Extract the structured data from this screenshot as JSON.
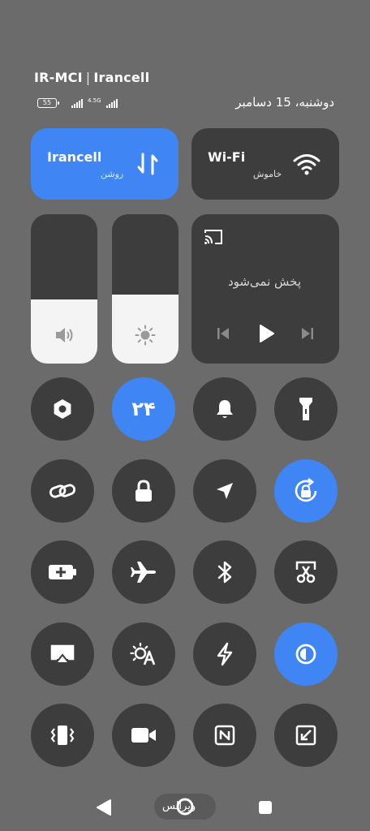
{
  "status": {
    "carrier1": "IR-MCI",
    "separator": "|",
    "carrier2": "Irancell",
    "battery": "55",
    "network": "4.5G",
    "date": "دوشنبه، 15 دسامبر"
  },
  "tiles": {
    "mobile": {
      "title": "Irancell",
      "status": "روشن"
    },
    "wifi": {
      "title": "Wi-Fi",
      "status": "خاموش"
    }
  },
  "sliders": {
    "volume_level": 0.43,
    "brightness_level": 0.46
  },
  "media": {
    "label": "پخش نمی‌شود"
  },
  "toggles": {
    "clock_label": "۲۴"
  },
  "nav": {
    "home_label": "ویرالس"
  },
  "colors": {
    "accent": "#3f86f4",
    "tile": "#3d3d3d",
    "background": "#6b6b6b"
  }
}
